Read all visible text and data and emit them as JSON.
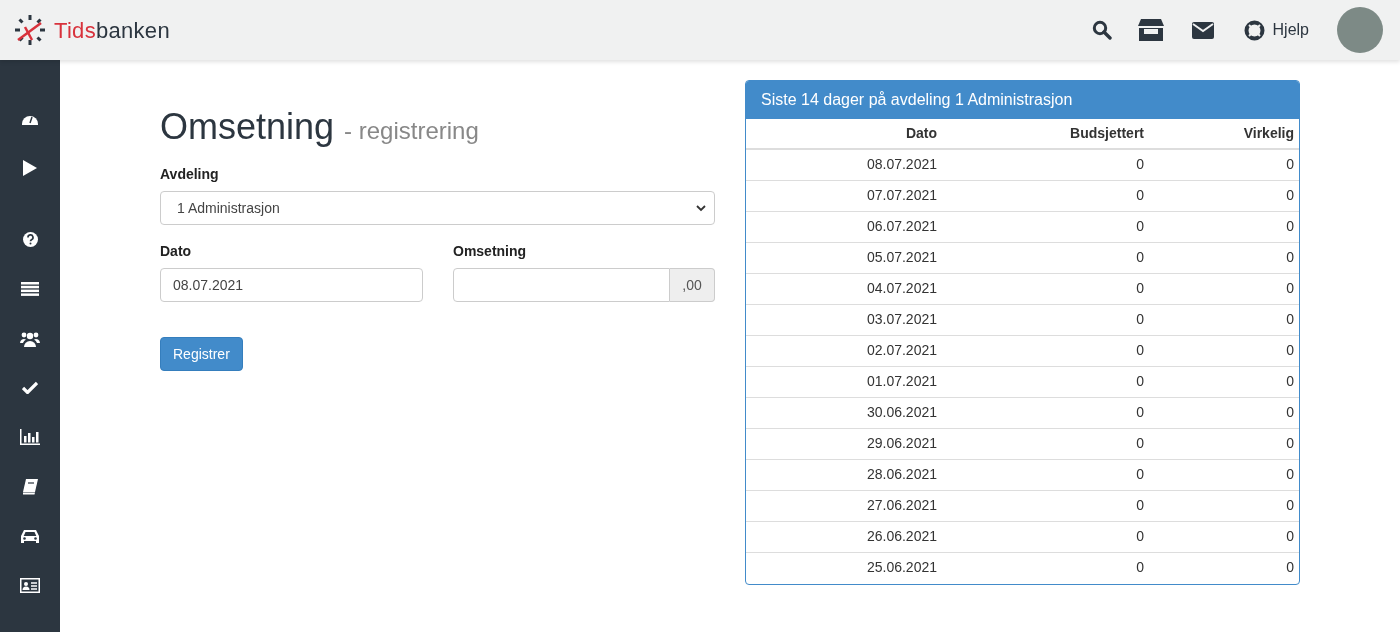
{
  "header": {
    "logo": {
      "accent": "Tids",
      "rest": "banken"
    },
    "help_label": "Hjelp"
  },
  "form": {
    "title": "Omsetning",
    "subtitle": "- registrering",
    "department": {
      "label": "Avdeling",
      "value": "1 Administrasjon"
    },
    "date": {
      "label": "Dato",
      "value": "08.07.2021"
    },
    "revenue": {
      "label": "Omsetning",
      "suffix": ",00"
    },
    "submit": "Registrer"
  },
  "panel": {
    "title": "Siste 14 dager på avdeling 1 Administrasjon",
    "columns": [
      "Dato",
      "Budsjettert",
      "Virkelig"
    ],
    "rows": [
      [
        "08.07.2021",
        "0",
        "0"
      ],
      [
        "07.07.2021",
        "0",
        "0"
      ],
      [
        "06.07.2021",
        "0",
        "0"
      ],
      [
        "05.07.2021",
        "0",
        "0"
      ],
      [
        "04.07.2021",
        "0",
        "0"
      ],
      [
        "03.07.2021",
        "0",
        "0"
      ],
      [
        "02.07.2021",
        "0",
        "0"
      ],
      [
        "01.07.2021",
        "0",
        "0"
      ],
      [
        "30.06.2021",
        "0",
        "0"
      ],
      [
        "29.06.2021",
        "0",
        "0"
      ],
      [
        "28.06.2021",
        "0",
        "0"
      ],
      [
        "27.06.2021",
        "0",
        "0"
      ],
      [
        "26.06.2021",
        "0",
        "0"
      ],
      [
        "25.06.2021",
        "0",
        "0"
      ]
    ]
  }
}
